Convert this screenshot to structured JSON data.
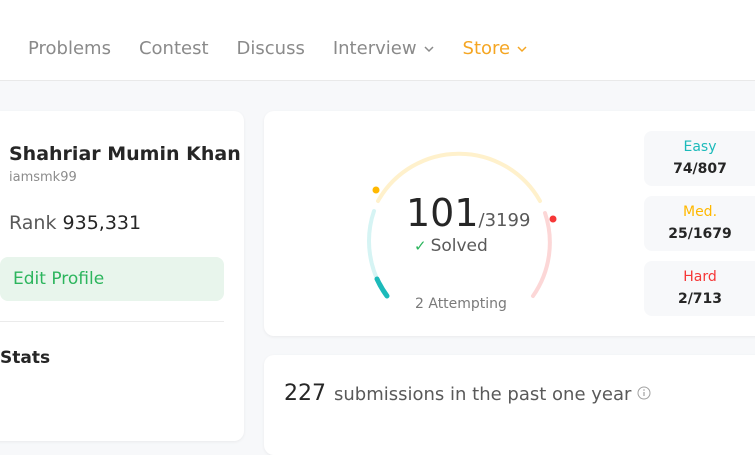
{
  "nav": {
    "items": [
      {
        "label": "Problems"
      },
      {
        "label": "Contest"
      },
      {
        "label": "Discuss"
      },
      {
        "label": "Interview"
      },
      {
        "label": "Store"
      }
    ]
  },
  "profile": {
    "name": "Shahriar Mumin Khan",
    "username": "iamsmk99",
    "rank_label": "Rank",
    "rank_value": "935,331",
    "edit_button": "Edit Profile",
    "stats_title": "Stats"
  },
  "solved": {
    "count": "101",
    "total": "/3199",
    "label": "Solved",
    "attempting": "2 Attempting",
    "difficulties": [
      {
        "label": "Easy",
        "value": "74/807",
        "color": "#1cbaba"
      },
      {
        "label": "Med.",
        "value": "25/1679",
        "color": "#ffb800"
      },
      {
        "label": "Hard",
        "value": "2/713",
        "color": "#f63737"
      }
    ]
  },
  "submissions": {
    "count": "227",
    "text": "submissions in the past one year"
  },
  "colors": {
    "accent_orange": "#f5a623",
    "green": "#2cb55d",
    "easy": "#1cbaba",
    "medium": "#ffb800",
    "hard": "#f63737"
  }
}
